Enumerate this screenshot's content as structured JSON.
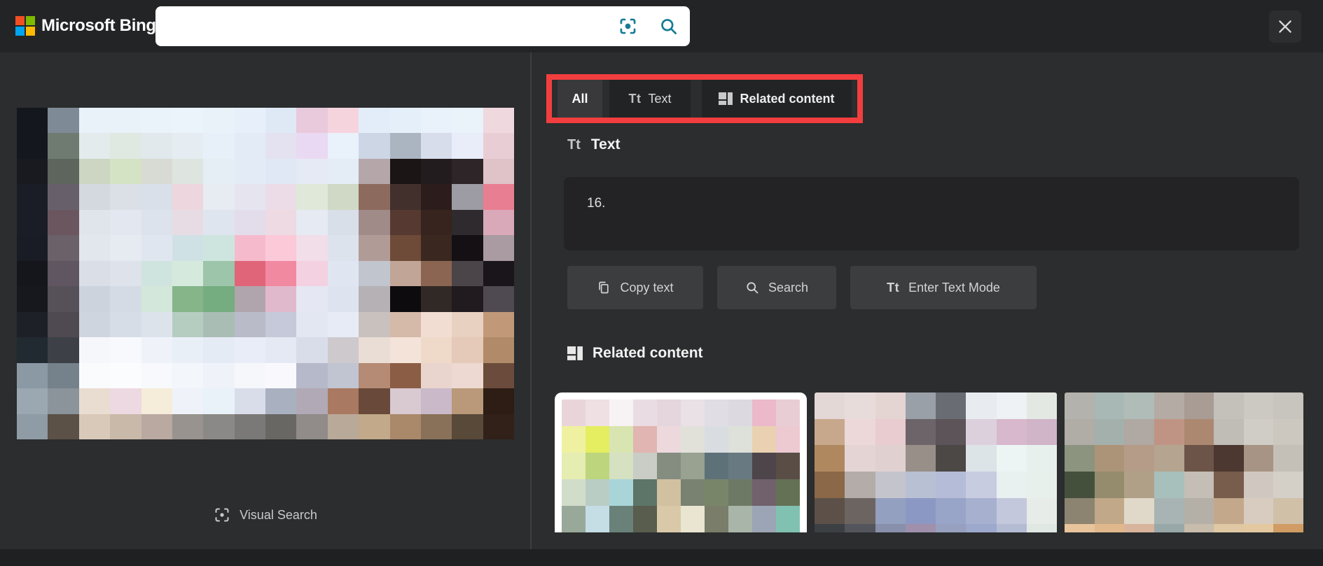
{
  "header": {
    "brand": "Microsoft Bing",
    "search": {
      "value": "",
      "aria": "Search"
    }
  },
  "brand_logo_colors": [
    "#f25022",
    "#7fba00",
    "#00a4ef",
    "#ffb900"
  ],
  "colors": {
    "header_bg": "#232426",
    "panel_bg": "#2b2d2e",
    "tab_active_bg": "#39393b",
    "tab_bg": "#222325",
    "box_bg": "#232325",
    "button_bg": "#3c3d3f",
    "footer_bg": "#1f2021",
    "card_bg": "#ffffff",
    "accent_teal": "#157c95",
    "highlight_red": "#f23e3e",
    "divider": "#3c3e40"
  },
  "tabs": {
    "all": {
      "label": "All",
      "active": true
    },
    "text": {
      "label": "Text",
      "icon_glyph": "Tt"
    },
    "related": {
      "label": "Related content"
    }
  },
  "text_section": {
    "icon_glyph": "Tt",
    "title": "Text",
    "extracted_text": "16.",
    "buttons": {
      "copy": "Copy text",
      "search": "Search",
      "enter_text_mode": "Enter Text Mode",
      "enter_text_mode_icon_glyph": "Tt"
    }
  },
  "related_section": {
    "title": "Related content"
  },
  "left_panel": {
    "visual_search_label": "Visual Search"
  },
  "mosaics": {
    "main": [
      [
        "#15171f",
        "#7e8a95",
        "#e9f1f9",
        "#e9f1f9",
        "#eaf2fa",
        "#ebf3fb",
        "#e9f1f9",
        "#e7effa",
        "#dfe9f6",
        "#e9c9dc",
        "#f6d4de",
        "#e3edf9",
        "#e5effa",
        "#e9f1fb",
        "#eaf2fa",
        "#efd8de"
      ],
      [
        "#15171f",
        "#6f7b70",
        "#e3ebec",
        "#dfe9e2",
        "#e2e9ec",
        "#e5edf2",
        "#e7eff8",
        "#e3ebf6",
        "#e4e2f1",
        "#ead9f2",
        "#e9f1fb",
        "#ccd6e4",
        "#abb4c1",
        "#d7ddeb",
        "#e9edf9",
        "#e9cdd5"
      ],
      [
        "#181a20",
        "#5d655d",
        "#ccd6c3",
        "#d5e3c5",
        "#d8dbd3",
        "#dee4e0",
        "#e5edf5",
        "#e3ebf7",
        "#e0e8f5",
        "#e6eaf5",
        "#e4ecf6",
        "#b5a6aa",
        "#1b1516",
        "#231c1e",
        "#2d2527",
        "#e0c3c9"
      ],
      [
        "#1a1d25",
        "#67606a",
        "#d4d8df",
        "#dbe0e7",
        "#dae0e9",
        "#edd6dd",
        "#e7ecf3",
        "#e5e4ef",
        "#ebdce7",
        "#e0e8d9",
        "#d0d9c5",
        "#8d6a5e",
        "#42302c",
        "#2c1d1c",
        "#9d9ba3",
        "#e87e92"
      ],
      [
        "#1a1d25",
        "#6b5660",
        "#e0e4eb",
        "#e3e7f0",
        "#dde3ed",
        "#e8dce4",
        "#dfe5ef",
        "#e3ddeb",
        "#eddae3",
        "#e5eaf3",
        "#d9dfe9",
        "#a18b89",
        "#563930",
        "#38241e",
        "#2e2a2e",
        "#d9a9b9"
      ],
      [
        "#191c24",
        "#6b6169",
        "#e2e6ed",
        "#e6eaf1",
        "#e0e6ef",
        "#d0e1e5",
        "#cee5df",
        "#f5bbcd",
        "#fcc9d9",
        "#f1dee9",
        "#dde3ed",
        "#b19b97",
        "#6e4a38",
        "#3a2820",
        "#141014",
        "#a99ba1"
      ],
      [
        "#14161c",
        "#5f5661",
        "#dadee7",
        "#dee2eb",
        "#d0e4df",
        "#d5e9dd",
        "#9dc5a9",
        "#e16579",
        "#f189a1",
        "#f3d1e1",
        "#e0e6f1",
        "#c1c5cd",
        "#c1a597",
        "#8b6551",
        "#4b4549",
        "#19151a"
      ],
      [
        "#16181e",
        "#565159",
        "#cdd3dd",
        "#d5dbe5",
        "#d3e7db",
        "#85b589",
        "#75ad81",
        "#b1a5ad",
        "#e1b9cd",
        "#e5e7f3",
        "#dee4ef",
        "#b5b1b5",
        "#0d0b0d",
        "#312925",
        "#211b1f",
        "#4f4951"
      ],
      [
        "#1d2127",
        "#4f4951",
        "#cfd5df",
        "#d7dde7",
        "#dde3eb",
        "#b5cdc1",
        "#a9bdb5",
        "#b9bbc9",
        "#c5c9d9",
        "#e3e7f1",
        "#e7ebf5",
        "#c9c1bd",
        "#d5b9a9",
        "#f1ddd1",
        "#e9d1c1",
        "#c19979"
      ],
      [
        "#212931",
        "#3d4147",
        "#f5f7fb",
        "#f7f9fd",
        "#eff3f9",
        "#e9eff7",
        "#e5ebf5",
        "#e9edf7",
        "#e5e9f3",
        "#d9dde9",
        "#cdc9cd",
        "#e9ddd5",
        "#f3e3d9",
        "#efd9c9",
        "#e5c9b9",
        "#b18b69"
      ],
      [
        "#8b99a5",
        "#75818b",
        "#f9fbfd",
        "#fbfcfe",
        "#f7f9fd",
        "#f3f7fb",
        "#eff3f9",
        "#f5f7fb",
        "#f9f9fd",
        "#b5b9c9",
        "#c1c5d1",
        "#b58b75",
        "#8b5d45",
        "#e9d5cd",
        "#edd9d1",
        "#6b4b3b"
      ],
      [
        "#9ba7b1",
        "#8b939b",
        "#e9ddd1",
        "#edd9e1",
        "#f5edd9",
        "#eff3f9",
        "#e9f1f9",
        "#d9dde9",
        "#a9b1c1",
        "#b1a9b5",
        "#a97961",
        "#694939",
        "#d9c9d1",
        "#c9b9c9",
        "#b99979",
        "#2d1d15"
      ],
      [
        "#8f9ba5",
        "#5b5147",
        "#d9c9b9",
        "#c9b9a9",
        "#b9a9a1",
        "#99938f",
        "#8b8987",
        "#7b7977",
        "#696763",
        "#918b89",
        "#b9a999",
        "#c1a989",
        "#a98969",
        "#897159",
        "#594939",
        "#312119"
      ]
    ],
    "thumb1": [
      [
        "#e9d5d9",
        "#eee0e3",
        "#f7f3f5",
        "#e9dde3",
        "#e5d5dd",
        "#e9e1e5",
        "#e1dde5",
        "#ddd9e1",
        "#ebb9c9",
        "#e9cdd5"
      ],
      [
        "#eff1a1",
        "#e5ed61",
        "#d9e5b1",
        "#e1b5b1",
        "#edd9dd",
        "#e1e1d9",
        "#d9dde1",
        "#dde1d9",
        "#e9d1b1",
        "#edc9d1"
      ],
      [
        "#e5edb1",
        "#bdd57d",
        "#d5e1c1",
        "#c9cdc5",
        "#858d81",
        "#99a191",
        "#5d7179",
        "#697981",
        "#4d4549",
        "#594d45"
      ],
      [
        "#d1ddc9",
        "#b9cdc5",
        "#a9d5d9",
        "#5d7569",
        "#d1c1a1",
        "#798171",
        "#798569",
        "#6d7965",
        "#71616d",
        "#657155"
      ],
      [
        "#99a999",
        "#c5dde5",
        "#698179",
        "#595d4d",
        "#d9c9a9",
        "#e9e5d1",
        "#797d69",
        "#a9b5a9",
        "#9ba5b5",
        "#81c1b1"
      ],
      [
        "#a1c161",
        "#516d51",
        "#c9d9c9",
        "#f1f5f1",
        "#e9f1ed",
        "#497961",
        "#69a189",
        "#91b599",
        "#d1e1c1",
        "#89a979"
      ]
    ],
    "thumb2": [
      [
        "#e4d8d6",
        "#e8dcda",
        "#e4d4d2",
        "#9aa0a8",
        "#6a6c74",
        "#e8ecf0",
        "#eef2f4",
        "#e4e8e2"
      ],
      [
        "#c8a88c",
        "#ecd8d8",
        "#e8ccd0",
        "#6c6468",
        "#5c5458",
        "#dcd0dc",
        "#d8b8cc",
        "#d0b4c8"
      ],
      [
        "#b08860",
        "#e4d4d4",
        "#e0d0d0",
        "#989088",
        "#4c4846",
        "#dce4e8",
        "#ecf4f4",
        "#e8f0ee"
      ],
      [
        "#8a6848",
        "#b4aca8",
        "#c4c4cc",
        "#b8c0d4",
        "#b4bcd8",
        "#c8cce0",
        "#e8f0f0",
        "#e8f0ec"
      ],
      [
        "#5c5048",
        "#6c6460",
        "#94a0c0",
        "#8c98c4",
        "#98a4c8",
        "#a8b0d0",
        "#c4c8dc",
        "#e8ece8"
      ],
      [
        "#3c4044",
        "#54545c",
        "#8890ac",
        "#a090ac",
        "#98a0c0",
        "#9ca8cc",
        "#b4bcd4",
        "#e0e8e4"
      ]
    ],
    "thumb3": [
      [
        "#b4b2ac",
        "#a8b8b4",
        "#b0bcb8",
        "#b4aca4",
        "#a89c94",
        "#c4c0ba",
        "#ccc8c2",
        "#c8c4be"
      ],
      [
        "#b0aca6",
        "#a4b0ac",
        "#b0a8a2",
        "#c09484",
        "#ac8870",
        "#c0bcb6",
        "#d0ccc6",
        "#ccc8c0"
      ],
      [
        "#8c9480",
        "#ac9478",
        "#b49c88",
        "#b4a490",
        "#6c5448",
        "#4c3830",
        "#a89484",
        "#c4c0b8"
      ],
      [
        "#44503c",
        "#948c6c",
        "#b0a088",
        "#a8c0bc",
        "#c4beb6",
        "#785c4c",
        "#d0c8c0",
        "#d4d0c8"
      ],
      [
        "#8c8470",
        "#c0a888",
        "#e0d8c8",
        "#a8b4b4",
        "#b4b0a8",
        "#c4a88c",
        "#d8ccc0",
        "#d0c0a8"
      ],
      [
        "#e8c49c",
        "#e0b88c",
        "#d8b49c",
        "#98a8a8",
        "#c8bcac",
        "#e0c8a4",
        "#e4c8a0",
        "#d09c64"
      ]
    ]
  }
}
